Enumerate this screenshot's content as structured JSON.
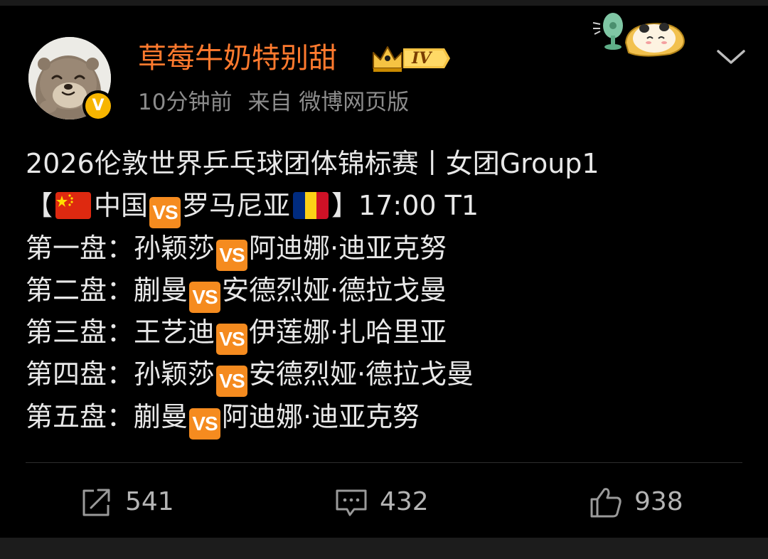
{
  "post": {
    "author": {
      "name": "草莓牛奶特别甜",
      "level": "IV",
      "verified_mark": "V"
    },
    "time": "10分钟前",
    "source": "来自 微博网页版",
    "lines": {
      "title": "2026伦敦世界乒乓球团体锦标赛丨女团Group1",
      "header": {
        "open": "【",
        "team_a": "中国",
        "vs": "VS",
        "team_b": "罗马尼亚",
        "close": "】17:00 T1"
      },
      "matches": [
        {
          "label": "第一盘：",
          "player_a": "孙颖莎",
          "vs": "VS",
          "player_b": "阿迪娜·迪亚克努"
        },
        {
          "label": "第二盘：",
          "player_a": "蒯曼",
          "vs": "VS",
          "player_b": "安德烈娅·德拉戈曼"
        },
        {
          "label": "第三盘：",
          "player_a": "王艺迪",
          "vs": "VS",
          "player_b": "伊莲娜·扎哈里亚"
        },
        {
          "label": "第四盘：",
          "player_a": "孙颖莎",
          "vs": "VS",
          "player_b": "安德烈娅·德拉戈曼"
        },
        {
          "label": "第五盘：",
          "player_a": "蒯曼",
          "vs": "VS",
          "player_b": "阿迪娜·迪亚克努"
        }
      ]
    }
  },
  "actions": {
    "repost": {
      "count": "541",
      "icon": "share-icon"
    },
    "comment": {
      "count": "432",
      "icon": "comment-icon"
    },
    "like": {
      "count": "938",
      "icon": "thumbs-up-icon"
    }
  },
  "colors": {
    "background": "#000000",
    "username": "#ff7a2e",
    "meta_text": "#8c8c8c",
    "body_text": "#e8e8e8",
    "vs_badge": "#f58b1f",
    "verified_badge": "#f7b500"
  }
}
